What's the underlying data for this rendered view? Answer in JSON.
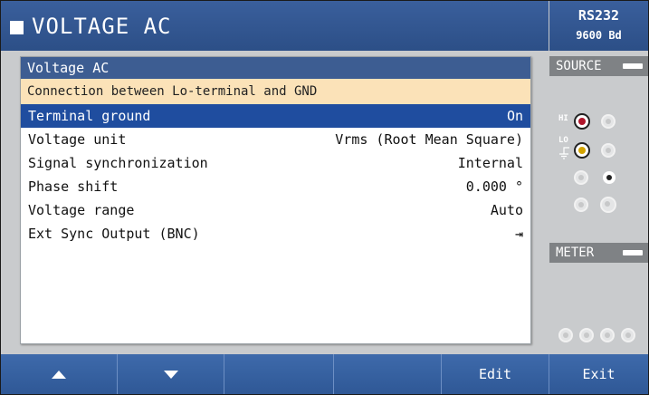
{
  "title": "VOLTAGE AC",
  "status": {
    "interface": "RS232",
    "baud": "9600 Bd"
  },
  "panel": {
    "header": "Voltage AC",
    "note": "Connection between Lo-terminal and GND",
    "rows": [
      {
        "label": "Terminal ground",
        "value": "On",
        "selected": true
      },
      {
        "label": "Voltage unit",
        "value": "Vrms (Root Mean Square)"
      },
      {
        "label": "Signal synchronization",
        "value": "Internal"
      },
      {
        "label": "Phase shift",
        "value": "0.000 °"
      },
      {
        "label": "Voltage range",
        "value": "Auto"
      },
      {
        "label": "Ext Sync Output (BNC)",
        "value": "⇥"
      }
    ]
  },
  "side": {
    "source_label": "SOURCE",
    "hi_label": "HI",
    "lo_label": "LO",
    "meter_label": "METER"
  },
  "softkeys": {
    "up_icon": "arrow-up-icon",
    "down_icon": "arrow-down-icon",
    "key3": "",
    "key4": "",
    "edit": "Edit",
    "exit": "Exit"
  }
}
